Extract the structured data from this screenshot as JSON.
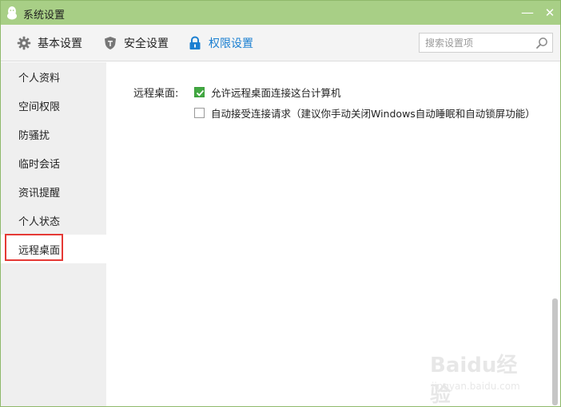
{
  "window": {
    "title": "系统设置",
    "minimize_glyph": "—",
    "close_glyph": "✕"
  },
  "toolbar": {
    "tabs": [
      {
        "label": "基本设置",
        "icon": "gear-icon",
        "active": false
      },
      {
        "label": "安全设置",
        "icon": "shield-icon",
        "active": false
      },
      {
        "label": "权限设置",
        "icon": "lock-icon",
        "active": true
      }
    ],
    "search": {
      "placeholder": "搜索设置项",
      "value": ""
    }
  },
  "sidebar": {
    "items": [
      {
        "label": "个人资料"
      },
      {
        "label": "空间权限"
      },
      {
        "label": "防骚扰"
      },
      {
        "label": "临时会话"
      },
      {
        "label": "资讯提醒"
      },
      {
        "label": "个人状态"
      },
      {
        "label": "远程桌面",
        "selected": true
      }
    ]
  },
  "content": {
    "section_label": "远程桌面:",
    "options": [
      {
        "label": "允许远程桌面连接这台计算机",
        "checked": true
      },
      {
        "label": "自动接受连接请求（建议你手动关闭Windows自动睡眠和自动锁屏功能）",
        "checked": false
      }
    ]
  },
  "colors": {
    "titlebar": "#a8cf86",
    "accent": "#1a7fd1",
    "check_green": "#42a842",
    "highlight_red": "#e53935"
  },
  "watermark": {
    "brand": "Baidu经验",
    "site": "jingyan.baidu.com"
  }
}
